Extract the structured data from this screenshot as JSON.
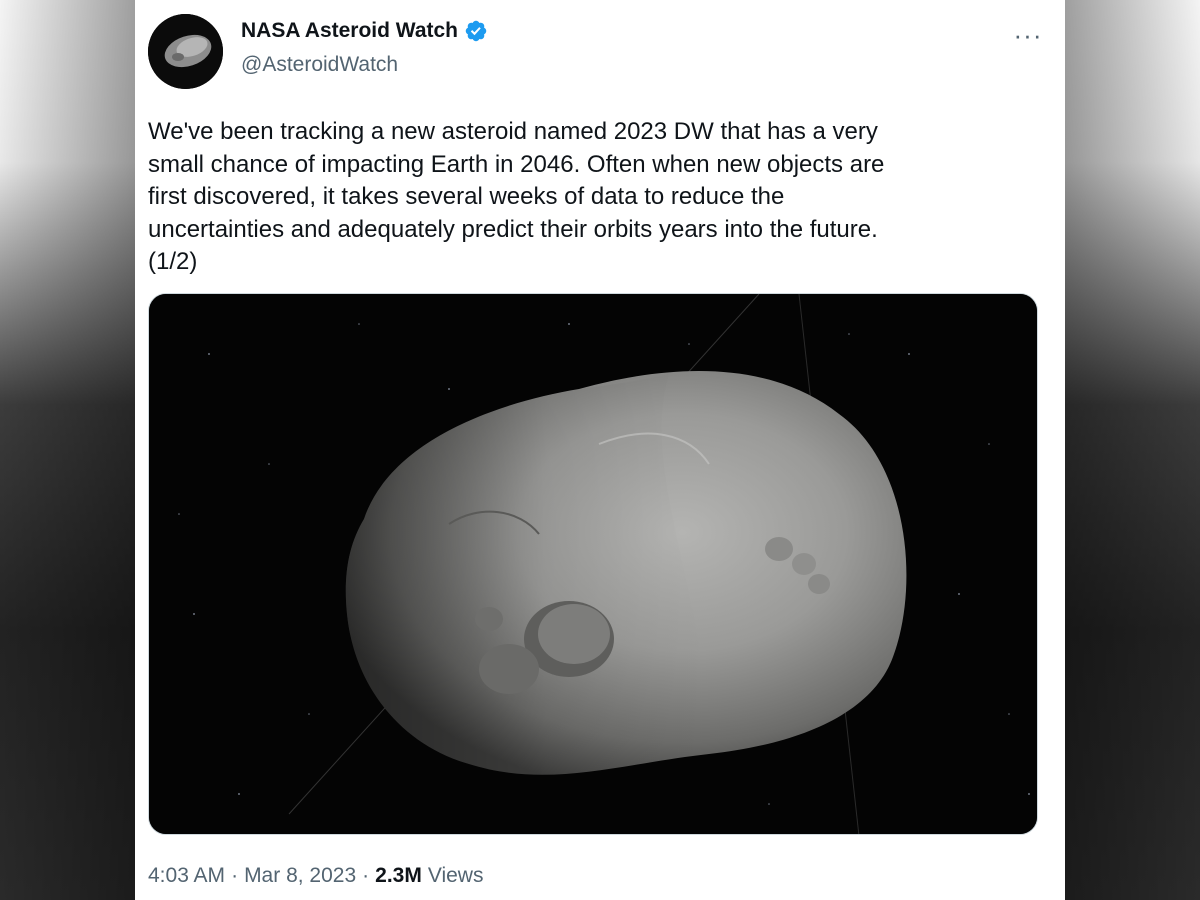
{
  "tweet": {
    "author_name": "NASA Asteroid Watch",
    "author_handle": "@AsteroidWatch",
    "verified": true,
    "more_icon": "more-horizontal-icon",
    "text": "We've been tracking a new asteroid named 2023 DW that has a very\nsmall chance of impacting Earth in 2046. Often when new objects are\nfirst discovered, it takes several weeks of data to reduce the\nuncertainties and adequately predict their orbits years into the future.\n(1/2)",
    "time": "4:03 AM",
    "date": "Mar 8, 2023",
    "views_count": "2.3M",
    "views_label": "Views",
    "separator": "·",
    "media_description_icon": "asteroid-image"
  },
  "colors": {
    "text_primary": "#0f1419",
    "text_secondary": "#536471",
    "verified_blue": "#1d9bf0",
    "card_background": "#ffffff"
  }
}
